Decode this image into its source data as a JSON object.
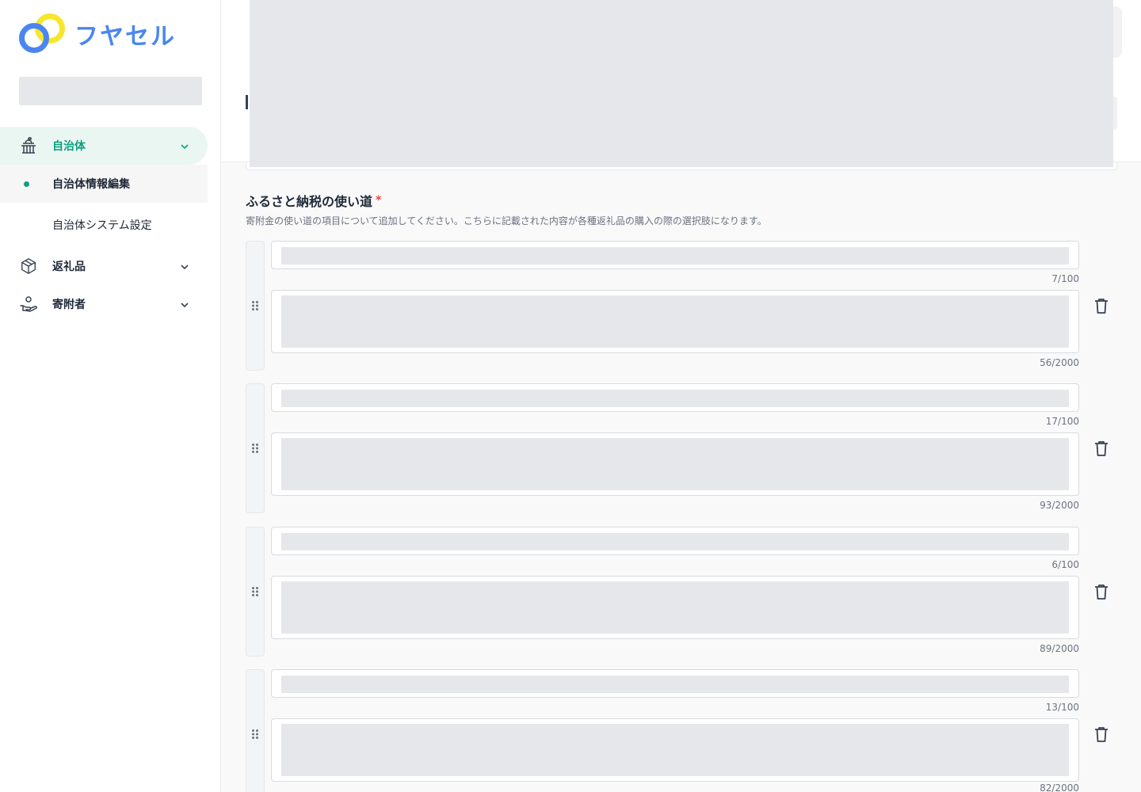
{
  "brand": {
    "logo_text": "フヤセル",
    "accent": "#0e9f7e",
    "brand_blue": "#4b86f0",
    "brand_yellow": "#f7e62b"
  },
  "sidebar": {
    "nav": [
      {
        "label": "自治体",
        "icon": "city-hall-icon",
        "expanded": true
      },
      {
        "label": "返礼品",
        "icon": "box-icon",
        "expanded": false
      },
      {
        "label": "寄附者",
        "icon": "hand-person-icon",
        "expanded": false
      }
    ],
    "sub_items": [
      {
        "label": "自治体情報編集",
        "current": true
      },
      {
        "label": "自治体システム設定",
        "current": false
      }
    ]
  },
  "section": {
    "title": "ふるさと納税の使い道",
    "required_mark": "*",
    "description": "寄附金の使い道の項目について追加してください。こちらに記載された内容が各種返礼品の購入の際の選択肢になります。"
  },
  "usage_items": [
    {
      "title_count": "7/100",
      "body_count": "56/2000"
    },
    {
      "title_count": "17/100",
      "body_count": "93/2000"
    },
    {
      "title_count": "6/100",
      "body_count": "89/2000"
    },
    {
      "title_count": "13/100",
      "body_count": "82/2000"
    }
  ]
}
